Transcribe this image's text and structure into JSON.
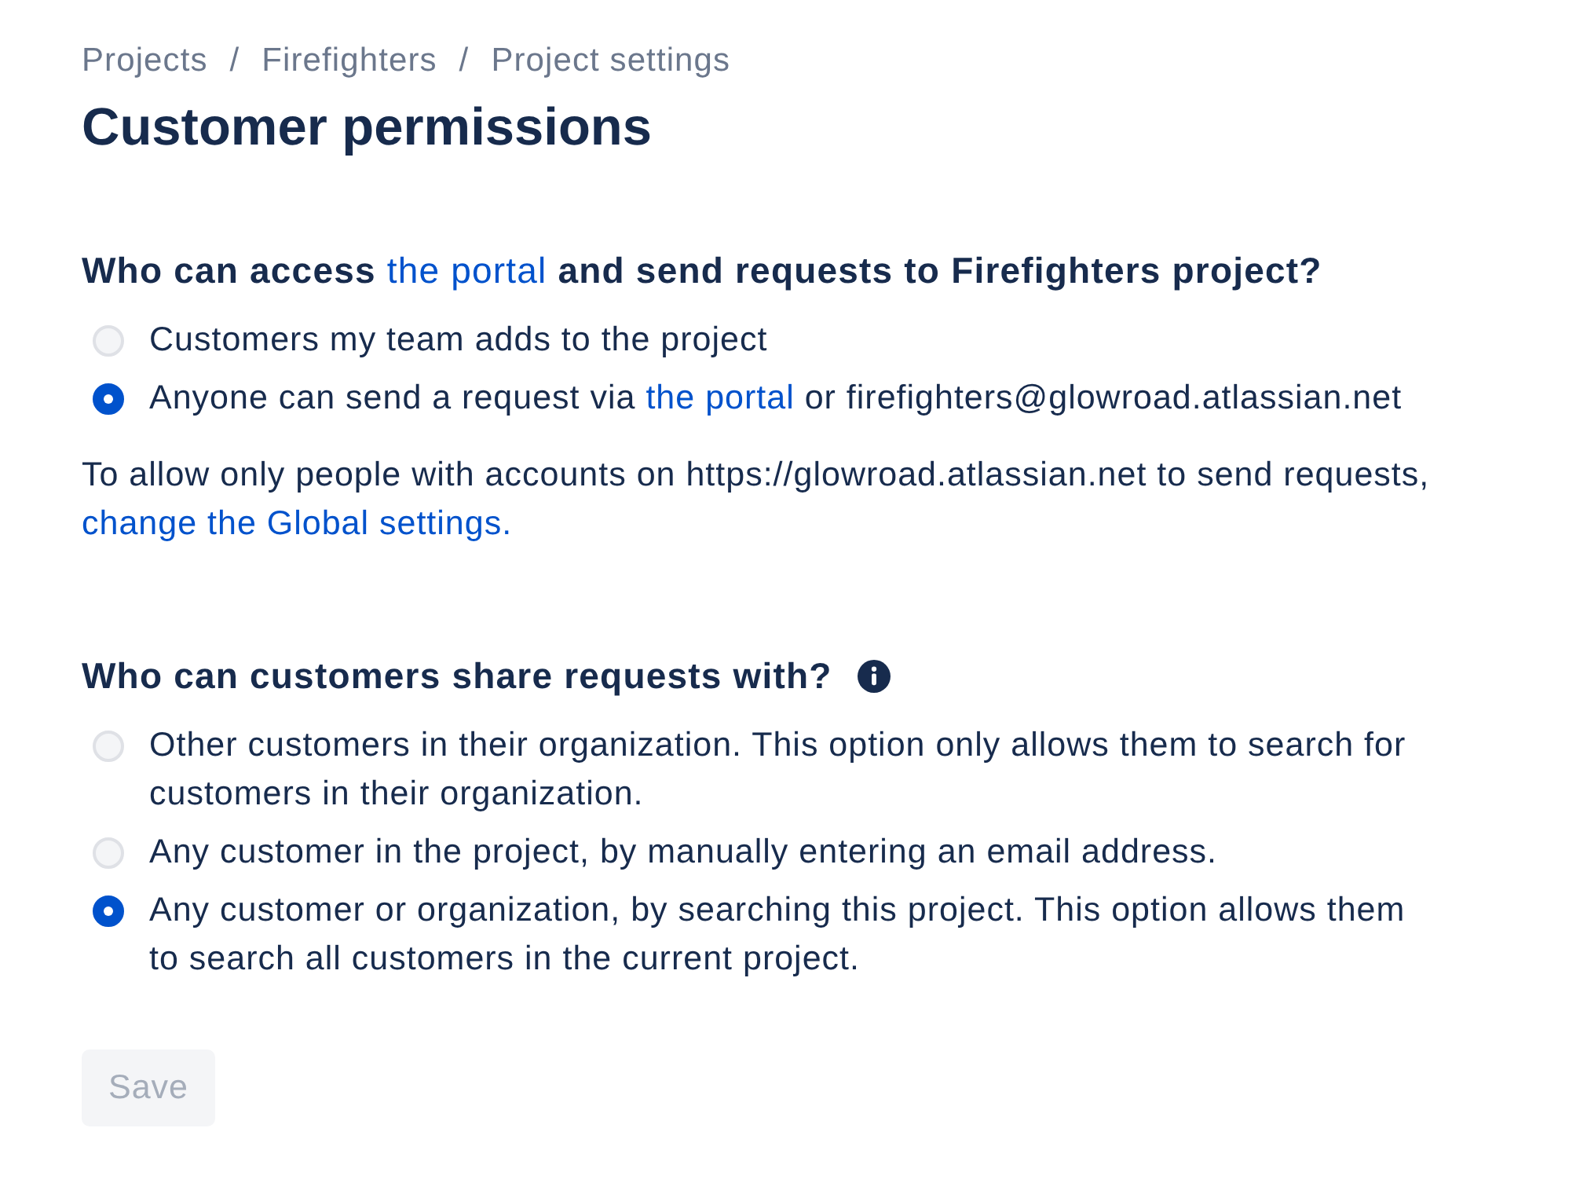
{
  "breadcrumbs": [
    {
      "kind": "link",
      "text": "Projects"
    },
    {
      "kind": "separator",
      "text": "/"
    },
    {
      "kind": "link",
      "text": "Firefighters"
    },
    {
      "kind": "separator",
      "text": "/"
    },
    {
      "kind": "link",
      "text": "Project settings"
    }
  ],
  "title": "Customer permissions",
  "sections": [
    {
      "heading": [
        {
          "kind": "text",
          "text": "Who can access "
        },
        {
          "kind": "link",
          "text": "the portal"
        },
        {
          "kind": "text",
          "text": " and send requests to Firefighters project?"
        }
      ],
      "info": false,
      "options": [
        {
          "parts": [
            {
              "kind": "text",
              "text": "Customers my team adds to the project"
            }
          ],
          "selected": false
        },
        {
          "parts": [
            {
              "kind": "text",
              "text": "Anyone can send a request via "
            },
            {
              "kind": "link",
              "text": "the portal"
            },
            {
              "kind": "text",
              "text": " or firefighters@glowroad.atlassian.net"
            }
          ],
          "selected": true
        }
      ],
      "note": [
        {
          "kind": "text",
          "text": "To allow only people with accounts on https://glowroad.atlassian.net to send requests, "
        },
        {
          "kind": "link",
          "text": "change the Global settings."
        }
      ]
    },
    {
      "heading": [
        {
          "kind": "text",
          "text": "Who can customers share requests with?"
        }
      ],
      "info": true,
      "options": [
        {
          "parts": [
            {
              "kind": "text",
              "text": "Other customers in their organization. This option only allows them to search for customers in their organization."
            }
          ],
          "selected": false
        },
        {
          "parts": [
            {
              "kind": "text",
              "text": "Any customer in the project, by manually entering an email address."
            }
          ],
          "selected": false
        },
        {
          "parts": [
            {
              "kind": "text",
              "text": "Any customer or organization, by searching this project. This option allows them to search all customers in the current project."
            }
          ],
          "selected": true
        }
      ]
    }
  ],
  "save_button": {
    "label": "Save",
    "disabled": true
  }
}
